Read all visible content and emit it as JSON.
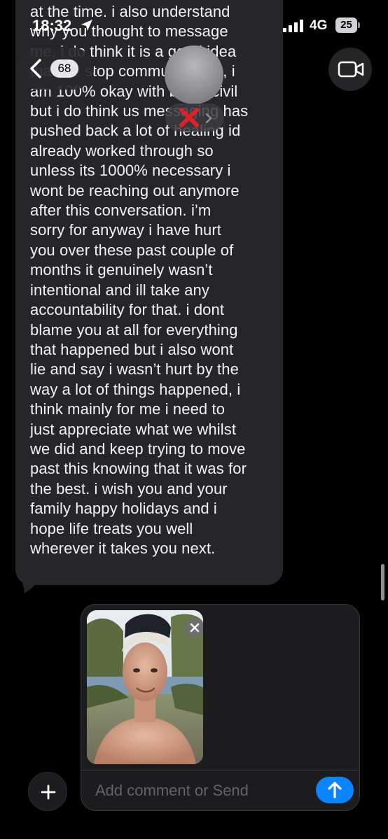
{
  "status_bar": {
    "time": "18:32",
    "location_icon": "location-arrow-icon",
    "signal_icon": "cellular-signal-icon",
    "network": "4G",
    "battery_level": "25"
  },
  "header": {
    "unread_count": "68",
    "back_icon": "chevron-left-icon",
    "video_icon": "video-camera-icon",
    "redaction_icon": "red-x-icon"
  },
  "message": {
    "text": "at the time. i also understand\nwhy you thought to message\nme, i do think it is a good idea\nthat we stop communicating, i\nam 100% okay with being civil\nbut i do think us messaging has\npushed back a lot of healing id\nalready worked through so\nunless its 1000% necessary i\nwont be reaching out anymore\nafter this conversation. i’m\nsorry for anyway i have hurt\nyou over these past couple of\nmonths it genuinely wasn’t\nintentional and ill take any\naccountability for that. i dont\nblame you at all for everything\nthat happened but i also wont\nlie and say i wasn’t hurt by the\nway a lot of things happened, i\nthink mainly for me i need to\njust appreciate what we whilst\nwe did and keep trying to move\npast this knowing that it was for\nthe best. i wish you and your\nfamily happy holidays and i\nhope life treats you well\nwherever it takes you next."
  },
  "compose": {
    "placeholder": "Add comment or Send",
    "value": "",
    "attachment_icon": "photo-thumbnail",
    "remove_icon": "close-icon",
    "send_icon": "arrow-up-icon",
    "add_icon": "plus-icon"
  },
  "colors": {
    "background": "#000000",
    "bubble": "#262628",
    "accent": "#0a84ff",
    "redaction": "#e0202a"
  }
}
